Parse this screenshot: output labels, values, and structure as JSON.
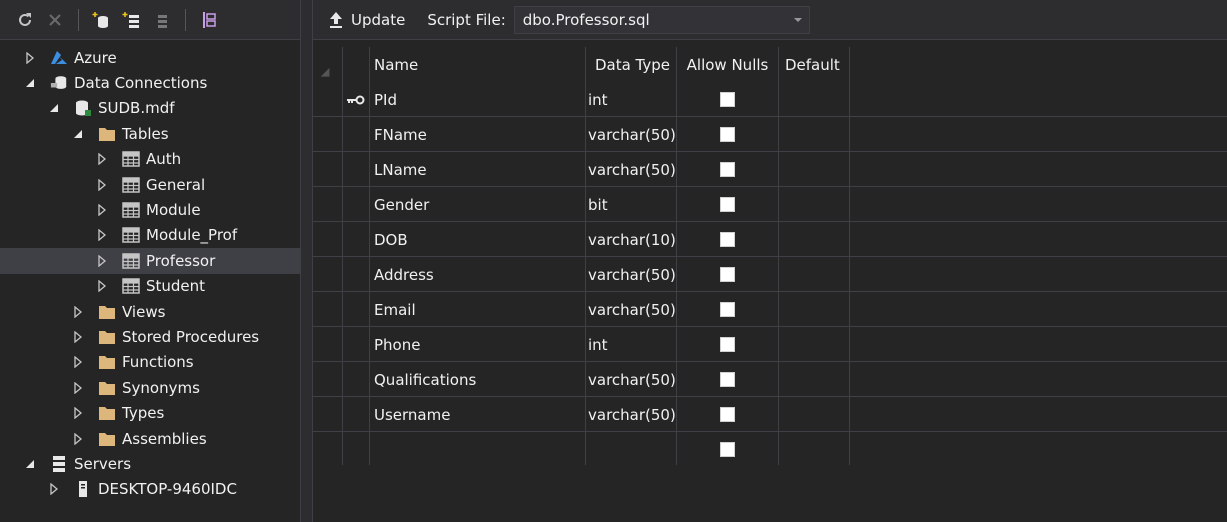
{
  "explorer": {
    "tree": [
      {
        "label": "Azure",
        "depth": 0,
        "expander": "collapsed",
        "icon": "azure-icon"
      },
      {
        "label": "Data Connections",
        "depth": 0,
        "expander": "expanded",
        "icon": "data-connections-icon"
      },
      {
        "label": "SUDB.mdf",
        "depth": 1,
        "expander": "expanded",
        "icon": "database-icon"
      },
      {
        "label": "Tables",
        "depth": 2,
        "expander": "expanded",
        "icon": "folder-icon"
      },
      {
        "label": "Auth",
        "depth": 3,
        "expander": "collapsed",
        "icon": "table-icon"
      },
      {
        "label": "General",
        "depth": 3,
        "expander": "collapsed",
        "icon": "table-icon"
      },
      {
        "label": "Module",
        "depth": 3,
        "expander": "collapsed",
        "icon": "table-icon"
      },
      {
        "label": "Module_Prof",
        "depth": 3,
        "expander": "collapsed",
        "icon": "table-icon"
      },
      {
        "label": "Professor",
        "depth": 3,
        "expander": "collapsed",
        "icon": "table-icon",
        "selected": true
      },
      {
        "label": "Student",
        "depth": 3,
        "expander": "collapsed",
        "icon": "table-icon"
      },
      {
        "label": "Views",
        "depth": 2,
        "expander": "collapsed",
        "icon": "folder-icon"
      },
      {
        "label": "Stored Procedures",
        "depth": 2,
        "expander": "collapsed",
        "icon": "folder-icon"
      },
      {
        "label": "Functions",
        "depth": 2,
        "expander": "collapsed",
        "icon": "folder-icon"
      },
      {
        "label": "Synonyms",
        "depth": 2,
        "expander": "collapsed",
        "icon": "folder-icon"
      },
      {
        "label": "Types",
        "depth": 2,
        "expander": "collapsed",
        "icon": "folder-icon"
      },
      {
        "label": "Assemblies",
        "depth": 2,
        "expander": "collapsed",
        "icon": "folder-icon"
      },
      {
        "label": "Servers",
        "depth": 0,
        "expander": "expanded",
        "icon": "servers-icon"
      },
      {
        "label": "DESKTOP-9460IDC",
        "depth": 1,
        "expander": "collapsed",
        "icon": "computer-icon"
      }
    ]
  },
  "designer": {
    "update_label": "Update",
    "script_file_label": "Script File:",
    "script_file_value": "dbo.Professor.sql",
    "headers": {
      "name": "Name",
      "data_type": "Data Type",
      "allow_nulls": "Allow Nulls",
      "default": "Default"
    },
    "columns": [
      {
        "name": "PId",
        "data_type": "int",
        "allow_nulls": true,
        "default": "",
        "primary_key": true
      },
      {
        "name": "FName",
        "data_type": "varchar(50)",
        "allow_nulls": true,
        "default": ""
      },
      {
        "name": "LName",
        "data_type": "varchar(50)",
        "allow_nulls": true,
        "default": ""
      },
      {
        "name": "Gender",
        "data_type": "bit",
        "allow_nulls": true,
        "default": ""
      },
      {
        "name": "DOB",
        "data_type": "varchar(10)",
        "allow_nulls": true,
        "default": ""
      },
      {
        "name": "Address",
        "data_type": "varchar(50)",
        "allow_nulls": true,
        "default": ""
      },
      {
        "name": "Email",
        "data_type": "varchar(50)",
        "allow_nulls": true,
        "default": ""
      },
      {
        "name": "Phone",
        "data_type": "int",
        "allow_nulls": true,
        "default": ""
      },
      {
        "name": "Qualifications",
        "data_type": "varchar(50)",
        "allow_nulls": true,
        "default": ""
      },
      {
        "name": "Username",
        "data_type": "varchar(50)",
        "allow_nulls": true,
        "default": ""
      },
      {
        "name": "",
        "data_type": "",
        "allow_nulls": true,
        "default": ""
      }
    ]
  },
  "colors": {
    "background": "#252526",
    "toolbar": "#2d2d30",
    "selection": "#3f3f46",
    "folder": "#dcb67a",
    "azure": "#3c8fe0"
  }
}
